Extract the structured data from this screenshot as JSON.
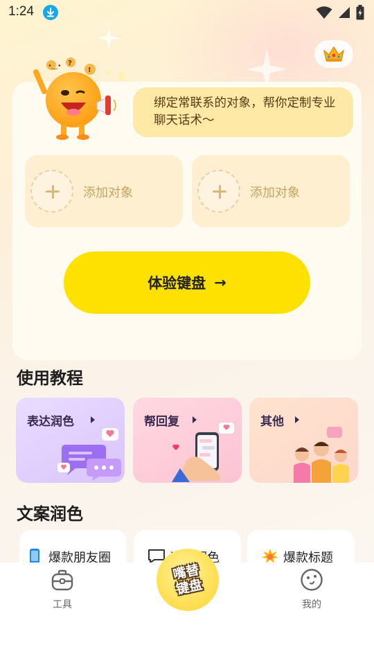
{
  "status": {
    "time": "1:24"
  },
  "bubble_text": "绑定常联系的对象，帮你定制专业聊天话术～",
  "add_targets": [
    {
      "label": "添加对象"
    },
    {
      "label": "添加对象"
    }
  ],
  "experience_button": {
    "label": "体验键盘",
    "arrow": "→"
  },
  "tutorial": {
    "title": "使用教程",
    "cards": [
      {
        "label": "表达润色"
      },
      {
        "label": "帮回复"
      },
      {
        "label": "其他"
      }
    ]
  },
  "copywriting": {
    "title": "文案润色",
    "cards": [
      {
        "label": "爆款朋友圈",
        "icon": "phone-icon"
      },
      {
        "label": "语句润色",
        "icon": "chat-icon"
      },
      {
        "label": "爆款标题",
        "icon": "burst-icon"
      }
    ]
  },
  "bottom_nav": {
    "tools": "工具",
    "center_line1": "嘴替",
    "center_line2": "键盘",
    "mine": "我的"
  },
  "colors": {
    "accent_yellow": "#ffe100",
    "bubble_bg": "#ffe9a6",
    "add_card_bg": "#fdefcf"
  }
}
